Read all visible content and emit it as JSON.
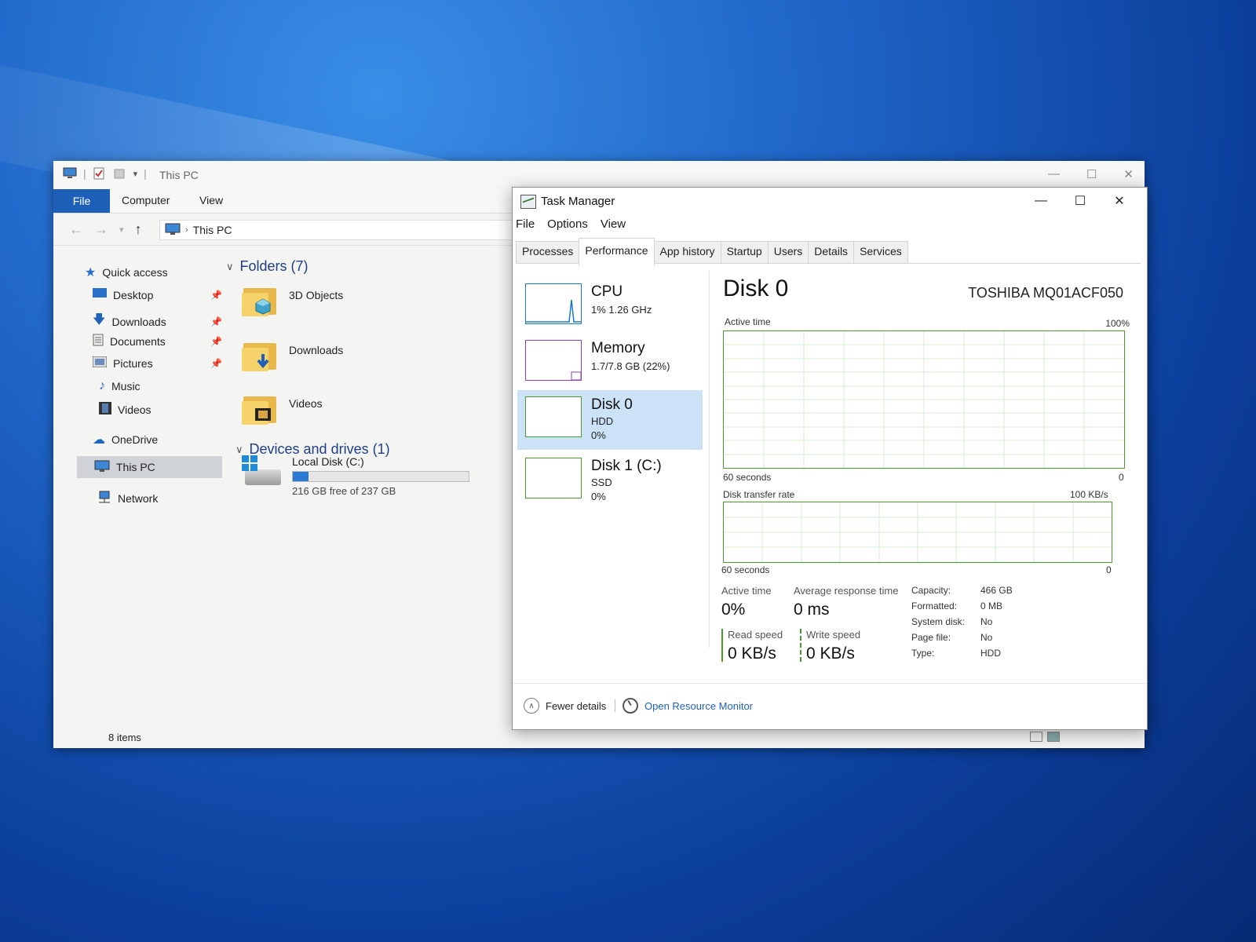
{
  "explorer": {
    "title": "This PC",
    "ribbon": {
      "file": "File",
      "computer": "Computer",
      "view": "View"
    },
    "address": {
      "path": "This PC"
    },
    "nav": {
      "quick_access": "Quick access",
      "desktop": "Desktop",
      "downloads": "Downloads",
      "documents": "Documents",
      "pictures": "Pictures",
      "music": "Music",
      "videos": "Videos",
      "onedrive": "OneDrive",
      "this_pc": "This PC",
      "network": "Network"
    },
    "folders_header": "Folders (7)",
    "folders": [
      {
        "name": "3D Objects"
      },
      {
        "name": "Downloads"
      },
      {
        "name": "Videos"
      }
    ],
    "devices_header": "Devices and drives (1)",
    "drive": {
      "name": "Local Disk (C:)",
      "free_text": "216 GB free of 237 GB",
      "used_fraction": 0.089
    },
    "status": "8 items"
  },
  "taskmanager": {
    "title": "Task Manager",
    "menu": {
      "file": "File",
      "options": "Options",
      "view": "View"
    },
    "tabs": [
      "Processes",
      "Performance",
      "App history",
      "Startup",
      "Users",
      "Details",
      "Services"
    ],
    "active_tab": "Performance",
    "resources": [
      {
        "name": "CPU",
        "line1": "1%  1.26 GHz",
        "line2": ""
      },
      {
        "name": "Memory",
        "line1": "1.7/7.8 GB (22%)",
        "line2": ""
      },
      {
        "name": "Disk 0",
        "line1": "HDD",
        "line2": "0%"
      },
      {
        "name": "Disk 1 (C:)",
        "line1": "SSD",
        "line2": "0%"
      }
    ],
    "disk": {
      "title": "Disk 0",
      "model": "TOSHIBA MQ01ACF050",
      "active_time_label": "Active time",
      "active_time_max": "100%",
      "graph_time_label": "60 seconds",
      "graph_min": "0",
      "transfer_label": "Disk transfer rate",
      "transfer_max": "100 KB/s",
      "stats": {
        "active_time_label": "Active time",
        "active_time_value": "0%",
        "avg_response_label": "Average response time",
        "avg_response_value": "0 ms",
        "read_label": "Read speed",
        "read_value": "0 KB/s",
        "write_label": "Write speed",
        "write_value": "0 KB/s"
      },
      "props": [
        {
          "key": "Capacity:",
          "value": "466 GB"
        },
        {
          "key": "Formatted:",
          "value": "0 MB"
        },
        {
          "key": "System disk:",
          "value": "No"
        },
        {
          "key": "Page file:",
          "value": "No"
        },
        {
          "key": "Type:",
          "value": "HDD"
        }
      ]
    },
    "footer": {
      "fewer": "Fewer details",
      "resmon": "Open Resource Monitor"
    }
  }
}
